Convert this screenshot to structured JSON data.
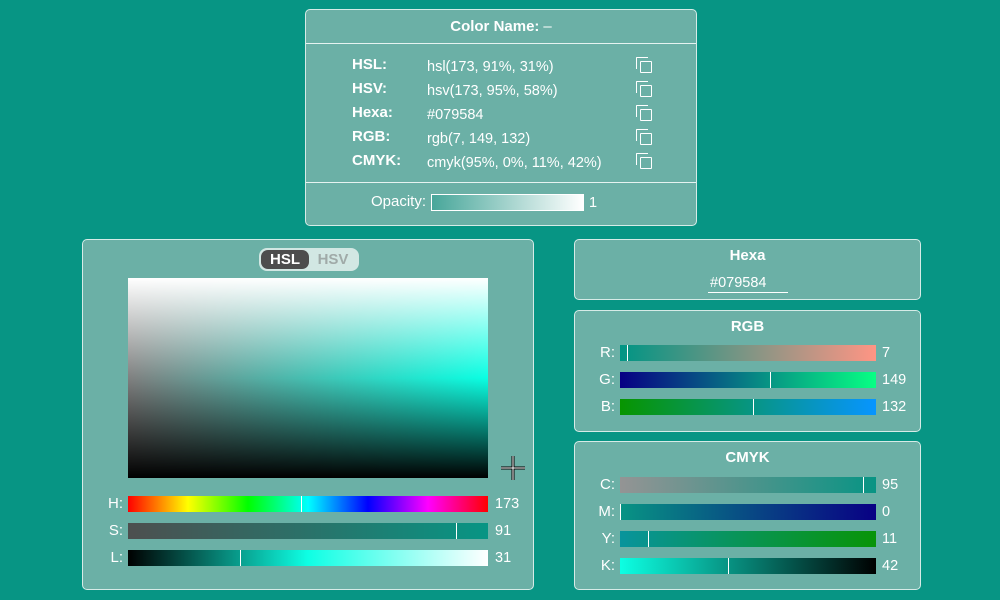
{
  "info": {
    "title_label": "Color Name:",
    "title_value": "–",
    "rows": [
      {
        "label": "HSL:",
        "value": "hsl(173, 91%, 31%)"
      },
      {
        "label": "HSV:",
        "value": "hsv(173, 95%, 58%)"
      },
      {
        "label": "Hexa:",
        "value": "#079584"
      },
      {
        "label": "RGB:",
        "value": "rgb(7, 149, 132)"
      },
      {
        "label": "CMYK:",
        "value": "cmyk(95%, 0%, 11%, 42%)"
      }
    ],
    "opacity_label": "Opacity:",
    "opacity_value": "1"
  },
  "picker": {
    "mode_options": [
      "HSL",
      "HSV"
    ],
    "active_mode": "HSL",
    "sliders": [
      {
        "label": "H:",
        "value": "173",
        "fraction": 0.48
      },
      {
        "label": "S:",
        "value": "91",
        "fraction": 0.91
      },
      {
        "label": "L:",
        "value": "31",
        "fraction": 0.31
      }
    ]
  },
  "hexa": {
    "title": "Hexa",
    "value": "#079584"
  },
  "rgb": {
    "title": "RGB",
    "sliders": [
      {
        "label": "R:",
        "value": "7",
        "fraction": 0.027
      },
      {
        "label": "G:",
        "value": "149",
        "fraction": 0.584
      },
      {
        "label": "B:",
        "value": "132",
        "fraction": 0.518
      }
    ]
  },
  "cmyk": {
    "title": "CMYK",
    "sliders": [
      {
        "label": "C:",
        "value": "95",
        "fraction": 0.95
      },
      {
        "label": "M:",
        "value": "0",
        "fraction": 0.0
      },
      {
        "label": "Y:",
        "value": "11",
        "fraction": 0.11
      },
      {
        "label": "K:",
        "value": "42",
        "fraction": 0.42
      }
    ]
  },
  "colors": {
    "background": "#079584",
    "panel": "#6bb0a6",
    "current": "#079584"
  }
}
